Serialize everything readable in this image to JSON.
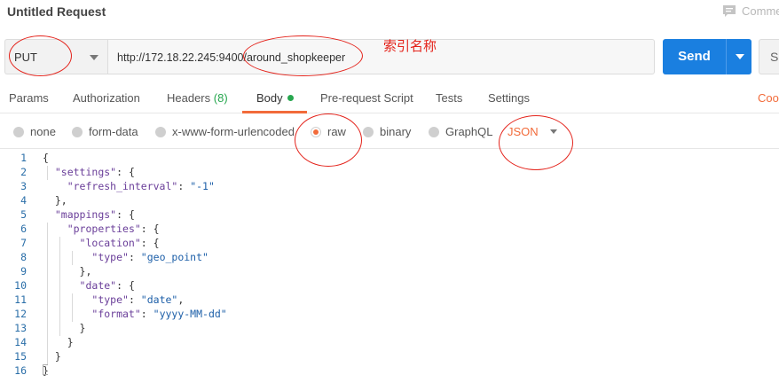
{
  "window": {
    "title": "Untitled Request",
    "comments_label": "Comme"
  },
  "request": {
    "method": "PUT",
    "url": "http://172.18.22.245:9400/around_shopkeeper",
    "send_label": "Send",
    "save_label": "Sa"
  },
  "annotation": {
    "text": "索引名称",
    "color": "#e4231b"
  },
  "tabs": {
    "params": "Params",
    "authorization": "Authorization",
    "headers": "Headers",
    "headers_count": "(8)",
    "body": "Body",
    "prerequest": "Pre-request Script",
    "tests": "Tests",
    "settings": "Settings",
    "cookies": "Cooki"
  },
  "body_types": {
    "none": "none",
    "form_data": "form-data",
    "urlencoded": "x-www-form-urlencoded",
    "raw": "raw",
    "binary": "binary",
    "graphql": "GraphQL",
    "selected": "raw",
    "format": "JSON"
  },
  "editor": {
    "line_numbers": [
      "1",
      "2",
      "3",
      "4",
      "5",
      "6",
      "7",
      "8",
      "9",
      "10",
      "11",
      "12",
      "13",
      "14",
      "15",
      "16"
    ],
    "lines": [
      [
        {
          "t": "p",
          "v": "{"
        }
      ],
      [
        {
          "t": "p",
          "v": "  "
        },
        {
          "t": "k",
          "v": "\"settings\""
        },
        {
          "t": "p",
          "v": ": {"
        }
      ],
      [
        {
          "t": "p",
          "v": "    "
        },
        {
          "t": "k",
          "v": "\"refresh_interval\""
        },
        {
          "t": "p",
          "v": ": "
        },
        {
          "t": "s",
          "v": "\"-1\""
        }
      ],
      [
        {
          "t": "p",
          "v": "  },"
        }
      ],
      [
        {
          "t": "p",
          "v": "  "
        },
        {
          "t": "k",
          "v": "\"mappings\""
        },
        {
          "t": "p",
          "v": ": {"
        }
      ],
      [
        {
          "t": "p",
          "v": "    "
        },
        {
          "t": "k",
          "v": "\"properties\""
        },
        {
          "t": "p",
          "v": ": {"
        }
      ],
      [
        {
          "t": "p",
          "v": "      "
        },
        {
          "t": "k",
          "v": "\"location\""
        },
        {
          "t": "p",
          "v": ": {"
        }
      ],
      [
        {
          "t": "p",
          "v": "        "
        },
        {
          "t": "k",
          "v": "\"type\""
        },
        {
          "t": "p",
          "v": ": "
        },
        {
          "t": "s",
          "v": "\"geo_point\""
        }
      ],
      [
        {
          "t": "p",
          "v": "      },"
        }
      ],
      [
        {
          "t": "p",
          "v": "      "
        },
        {
          "t": "k",
          "v": "\"date\""
        },
        {
          "t": "p",
          "v": ": {"
        }
      ],
      [
        {
          "t": "p",
          "v": "        "
        },
        {
          "t": "k",
          "v": "\"type\""
        },
        {
          "t": "p",
          "v": ": "
        },
        {
          "t": "s",
          "v": "\"date\""
        },
        {
          "t": "p",
          "v": ","
        }
      ],
      [
        {
          "t": "p",
          "v": "        "
        },
        {
          "t": "k",
          "v": "\"format\""
        },
        {
          "t": "p",
          "v": ": "
        },
        {
          "t": "s",
          "v": "\"yyyy-MM-dd\""
        }
      ],
      [
        {
          "t": "p",
          "v": "      }"
        }
      ],
      [
        {
          "t": "p",
          "v": "    }"
        }
      ],
      [
        {
          "t": "p",
          "v": "  }"
        }
      ],
      [
        {
          "t": "p",
          "v": "}"
        }
      ]
    ]
  },
  "colors": {
    "accent": "#f26b3a",
    "send": "#1a7fe0",
    "success": "#27a74f",
    "annotation": "#e4231b"
  }
}
